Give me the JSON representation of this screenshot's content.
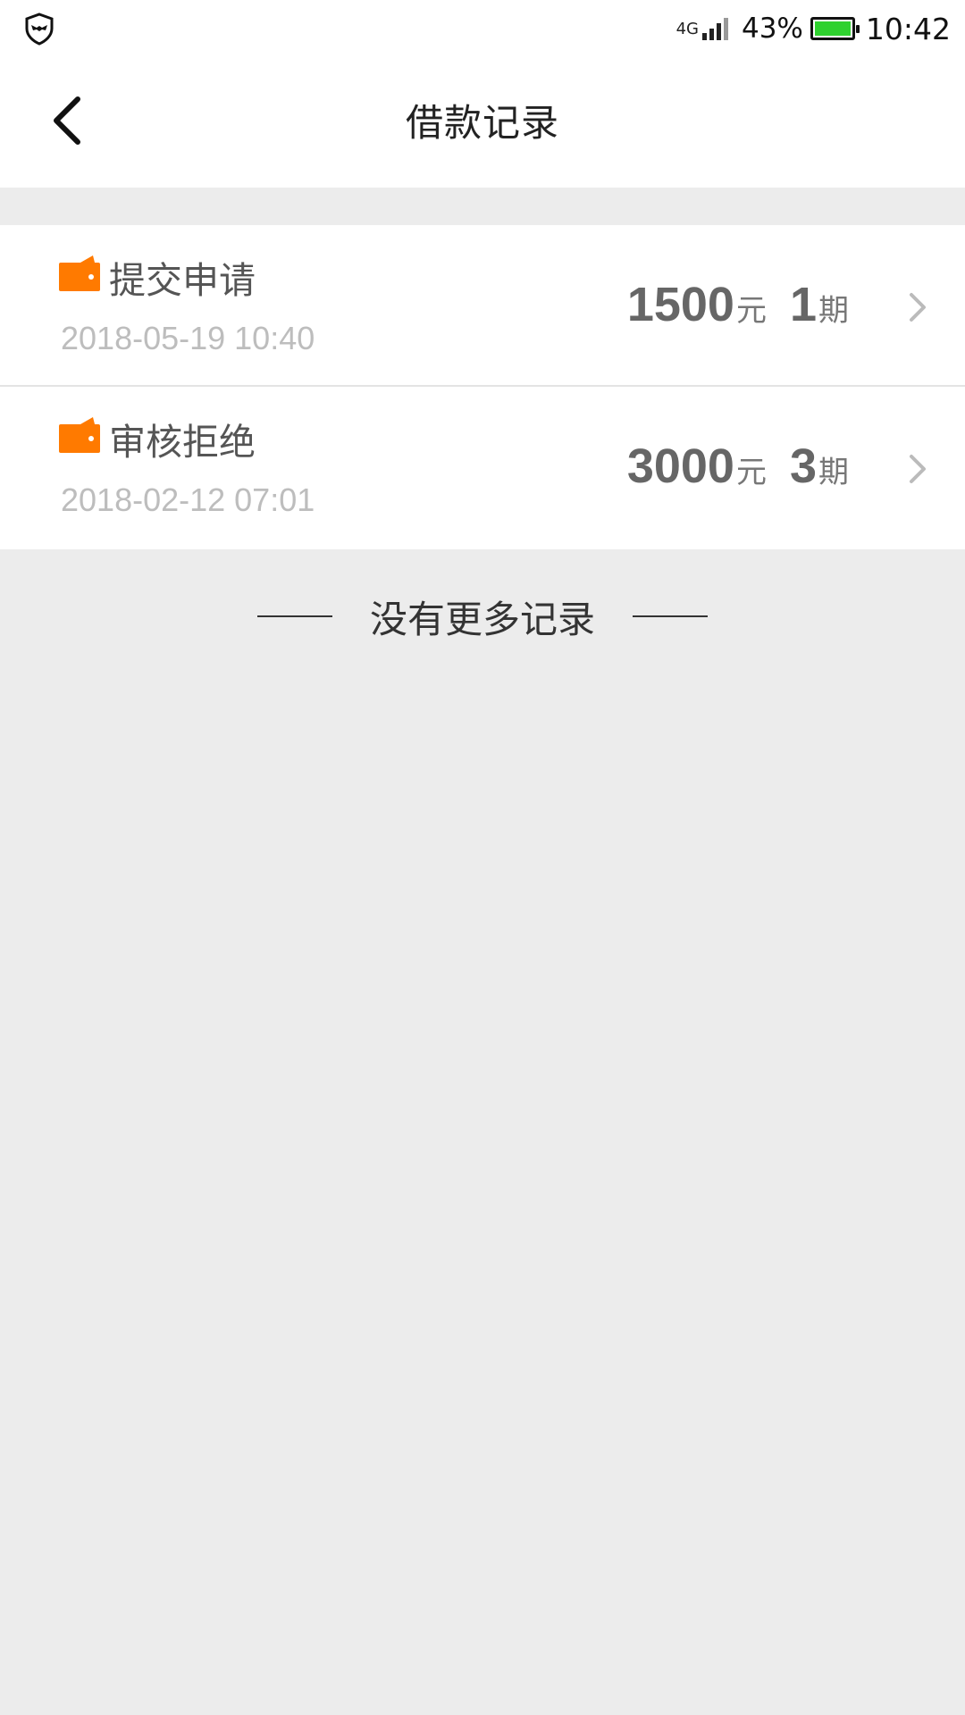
{
  "status_bar": {
    "network": "4G",
    "battery_percent": "43%",
    "time": "10:42",
    "battery_color": "#2fd12f"
  },
  "header": {
    "title": "借款记录",
    "back_icon": "chevron-left-icon"
  },
  "records": [
    {
      "status": "提交申请",
      "date": "2018-05-19 10:40",
      "amount": "1500",
      "amount_unit": "元",
      "periods": "1",
      "periods_unit": "期"
    },
    {
      "status": "审核拒绝",
      "date": "2018-02-12 07:01",
      "amount": "3000",
      "amount_unit": "元",
      "periods": "3",
      "periods_unit": "期"
    }
  ],
  "footer": {
    "no_more_text": "没有更多记录"
  },
  "colors": {
    "accent": "#ff7a00",
    "background": "#ececec"
  }
}
